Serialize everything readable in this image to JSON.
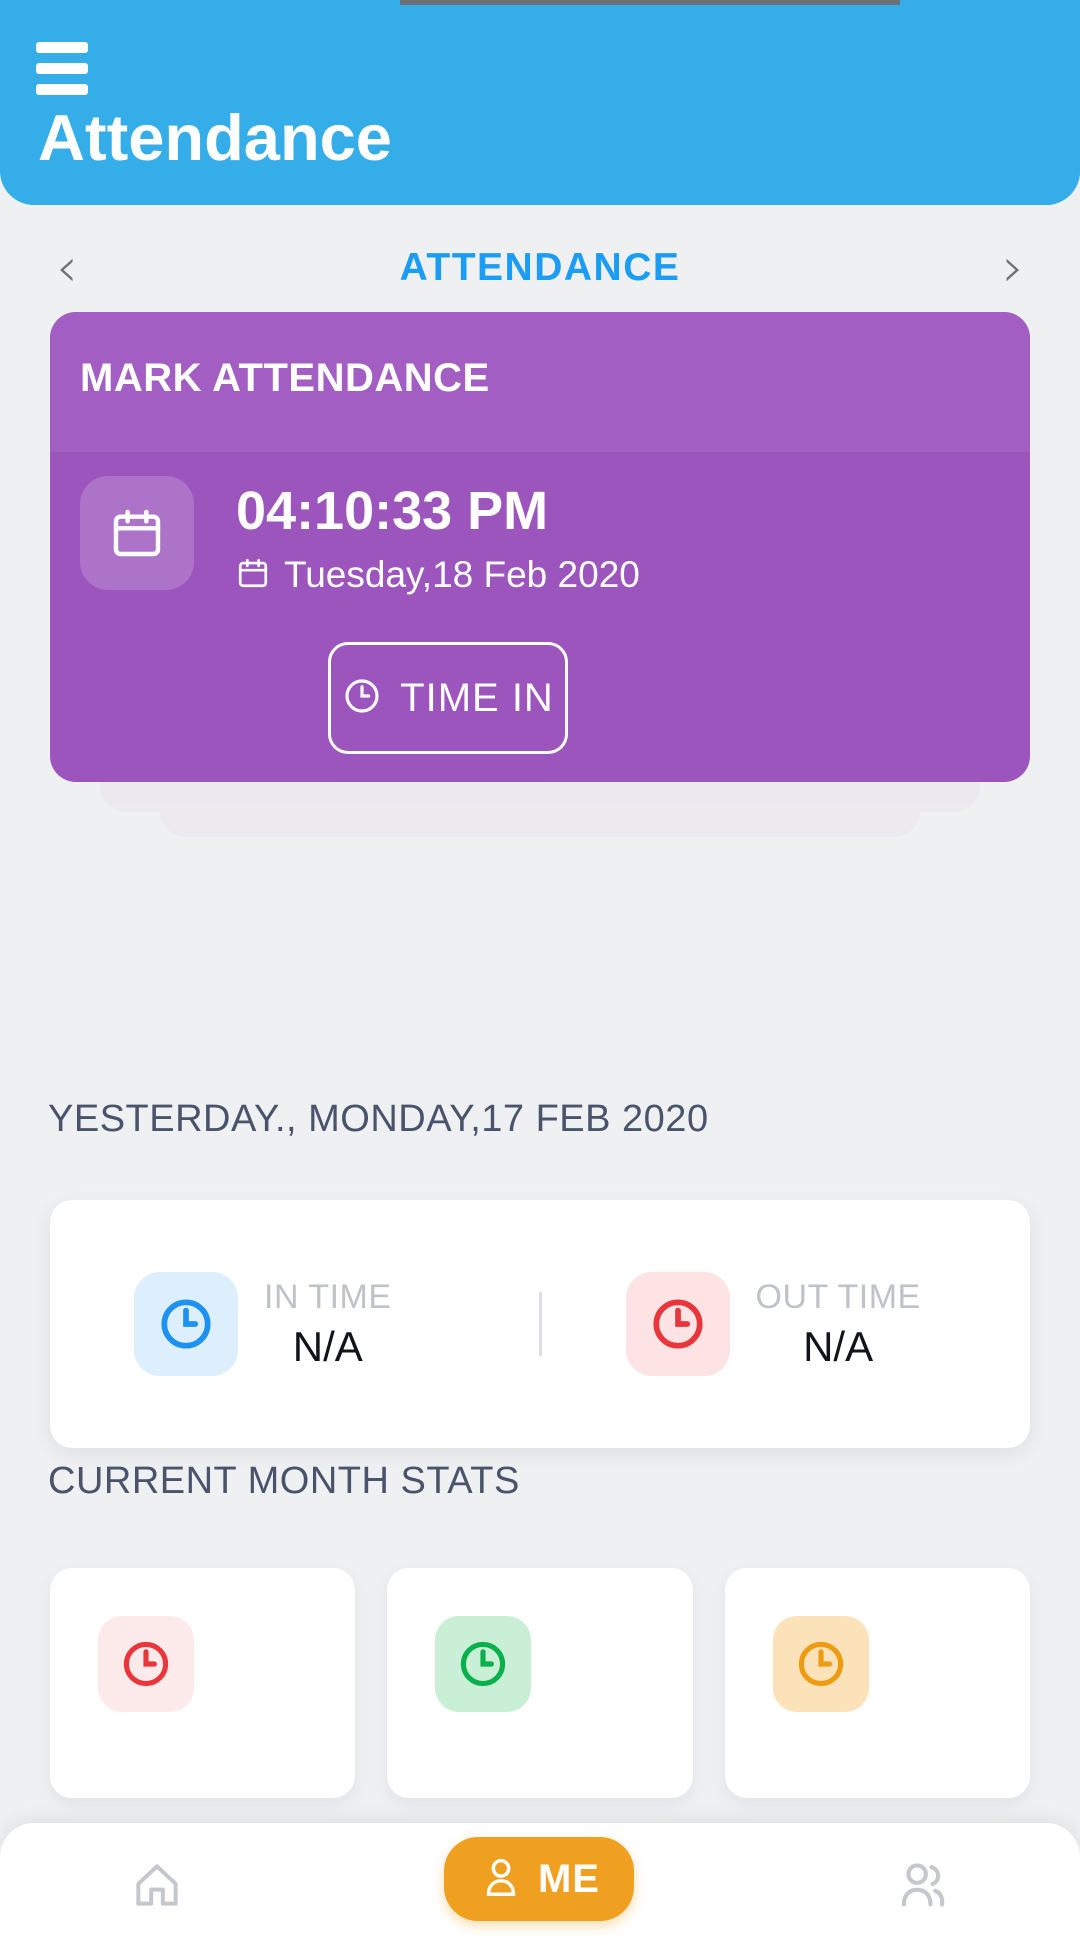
{
  "header": {
    "title": "Attendance",
    "menu_icon": "hamburger-menu-icon",
    "bg_color": "#35ade8",
    "bg_light_color": "#72c5f5",
    "bg_dark_color": "#0d8ffc"
  },
  "pager": {
    "prev_icon": "chevron-left-icon",
    "next_icon": "chevron-right-icon",
    "title": "ATTENDANCE",
    "title_color": "#1b9cf5"
  },
  "mark_card": {
    "heading": "MARK ATTENDANCE",
    "calendar_icon": "calendar-icon",
    "time": "04:10:33 PM",
    "date_icon": "calendar-icon",
    "date": "Tuesday,18 Feb 2020",
    "button_icon": "clock-icon",
    "button_label": "TIME IN",
    "card_color": "#9b55bd",
    "card_header_color": "#a25ec2"
  },
  "yesterday": {
    "section_label": "YESTERDAY., MONDAY,17 FEB 2020",
    "entries": [
      {
        "icon": "clock-icon",
        "icon_color": "#1e92f0",
        "chip_color": "#ddeefc",
        "label": "IN TIME",
        "value": "N/A"
      },
      {
        "icon": "clock-icon",
        "icon_color": "#e8363b",
        "chip_color": "#fde3e4",
        "label": "OUT TIME",
        "value": "N/A"
      }
    ]
  },
  "month_stats": {
    "section_label": "CURRENT MONTH STATS",
    "cards": [
      {
        "icon": "clock-icon",
        "icon_color": "#e8363b",
        "chip_color": "#fdeaea"
      },
      {
        "icon": "clock-icon",
        "icon_color": "#0ab04d",
        "chip_color": "#c9f0d7"
      },
      {
        "icon": "clock-icon",
        "icon_color": "#ee9b12",
        "chip_color": "#fbe2b8"
      }
    ]
  },
  "bottom_nav": {
    "items": [
      {
        "icon": "home-icon",
        "label": "",
        "active": false
      },
      {
        "icon": "person-icon",
        "label": "ME",
        "active": true
      },
      {
        "icon": "people-group-icon",
        "label": "",
        "active": false
      }
    ],
    "active_color": "#f0a020",
    "inactive_color": "#c4c7cb"
  }
}
